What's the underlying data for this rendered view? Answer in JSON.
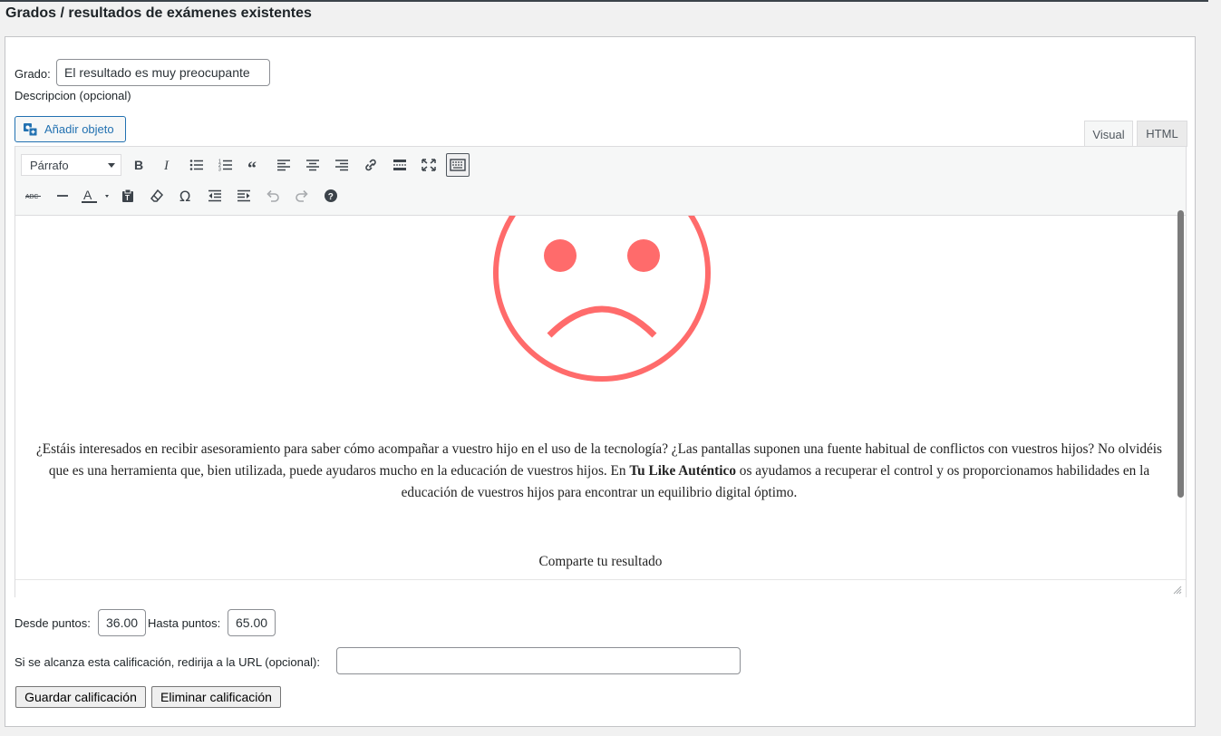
{
  "page": {
    "title": "Grados / resultados de exámenes existentes"
  },
  "grade": {
    "label": "Grado:",
    "value": "El resultado es muy preocupante"
  },
  "description": {
    "label": "Descripcion (opcional)"
  },
  "editor": {
    "add_media_label": "Añadir objeto",
    "tabs": {
      "visual": "Visual",
      "html": "HTML"
    },
    "format_select": "Párrafo",
    "toolbar_row1": [
      "bold-icon",
      "italic-icon",
      "bullet-list-icon",
      "numbered-list-icon",
      "blockquote-icon",
      "align-left-icon",
      "align-center-icon",
      "align-right-icon",
      "link-icon",
      "read-more-icon",
      "fullscreen-icon",
      "toolbar-toggle-icon"
    ],
    "toolbar_row2": [
      "strikethrough-icon",
      "horizontal-line-icon",
      "text-color-icon",
      "paste-text-icon",
      "clear-formatting-icon",
      "special-character-icon",
      "outdent-icon",
      "indent-icon",
      "undo-icon",
      "redo-icon",
      "help-icon"
    ],
    "content": {
      "image": "sad-face",
      "image_color": "#ff6b6b",
      "paragraph_before": "¿Estáis interesados en recibir asesoramiento para saber cómo acompañar a vuestro hijo en el uso de la tecnología? ¿Las pantallas suponen una fuente habitual de conflictos con vuestros hijos? No olvidéis que es una herramienta que, bien utilizada, puede ayudaros mucho en la educación de vuestros hijos. En ",
      "paragraph_bold": "Tu Like Auténtico",
      "paragraph_after": " os ayudamos a recuperar el control y os proporcionamos habilidades en la educación de vuestros hijos para encontrar un equilibrio digital óptimo.",
      "share_text": "Comparte tu resultado"
    }
  },
  "points": {
    "from_label": "Desde puntos:",
    "from_value": "36.00",
    "to_label": "Hasta puntos:",
    "to_value": "65.00"
  },
  "redirect": {
    "label": "Si se alcanza esta calificación, redirija a la URL (opcional):",
    "value": ""
  },
  "actions": {
    "save": "Guardar calificación",
    "delete": "Eliminar calificación"
  },
  "colors": {
    "link_blue": "#2271b1",
    "panel_border": "#c3c4c7"
  }
}
